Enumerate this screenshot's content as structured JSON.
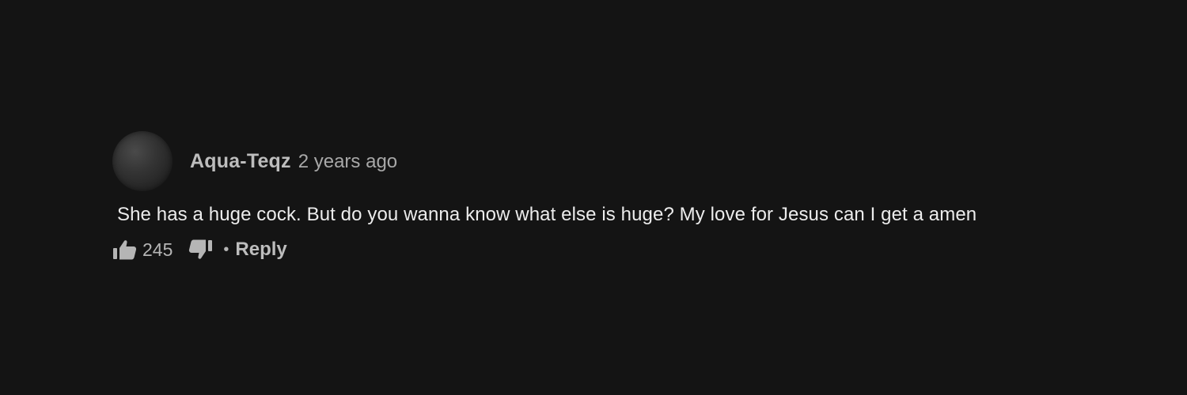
{
  "comment": {
    "author": "Aqua-Teqz",
    "timestamp": "2 years ago",
    "text": "She has a huge cock. But do you wanna know what else is huge? My love for Jesus can I get a amen",
    "like_count": "245",
    "separator": "•",
    "reply_label": "Reply",
    "icons": {
      "avatar": "avatar",
      "like": "thumbs-up-icon",
      "dislike": "thumbs-down-icon"
    }
  },
  "colors": {
    "background": "#141414",
    "author": "#bdbdbd",
    "timestamp": "#a8a8a8",
    "body_text": "#ececec"
  }
}
